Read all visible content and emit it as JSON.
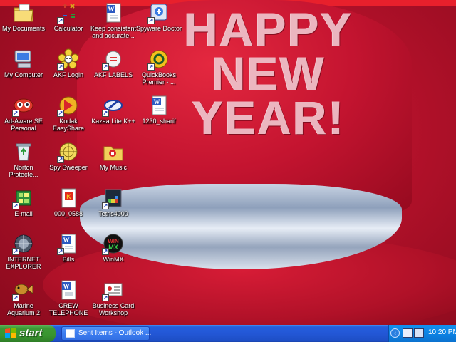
{
  "desktop": {
    "icons": [
      {
        "label": "My Documents",
        "icon": "folder-documents-icon"
      },
      {
        "label": "Calculator",
        "icon": "calculator-icon"
      },
      {
        "label": "Keep consistent and accurate...",
        "icon": "word-document-icon"
      },
      {
        "label": "Spyware Doctor",
        "icon": "spyware-doctor-icon"
      },
      {
        "label": "My Computer",
        "icon": "computer-icon"
      },
      {
        "label": "AKF Login",
        "icon": "flower-icon"
      },
      {
        "label": "AKF LABELS",
        "icon": "labels-icon"
      },
      {
        "label": "QuickBooks Premier - ...",
        "icon": "quickbooks-icon"
      },
      {
        "label": "Ad-Aware SE Personal",
        "icon": "ad-aware-icon"
      },
      {
        "label": "Kodak EasyShare",
        "icon": "kodak-icon"
      },
      {
        "label": "Kazaa Lite K++",
        "icon": "kazaa-icon"
      },
      {
        "label": "1230_sharif",
        "icon": "word-document-icon"
      },
      {
        "label": "Norton Protecte...",
        "icon": "recycle-bin-icon"
      },
      {
        "label": "Spy Sweeper",
        "icon": "spy-sweeper-icon"
      },
      {
        "label": "My Music",
        "icon": "music-icon"
      },
      {
        "label": "E-mail",
        "icon": "email-icon"
      },
      {
        "label": "000_0588",
        "icon": "kodak-image-icon"
      },
      {
        "label": "Tetris4000",
        "icon": "tetris-icon"
      },
      {
        "label": "INTERNET EXPLORER",
        "icon": "globe-icon"
      },
      {
        "label": "Bills",
        "icon": "word-document-icon"
      },
      {
        "label": "WinMX",
        "icon": "winmx-icon"
      },
      {
        "label": "Marine Aquarium 2",
        "icon": "aquarium-icon"
      },
      {
        "label": "CREW TELEPHONE",
        "icon": "word-document-icon"
      },
      {
        "label": "Business Card Workshop",
        "icon": "business-card-icon"
      }
    ]
  },
  "wallpaper": {
    "lines": [
      "HAPPY",
      "NEW",
      "YEAR!"
    ]
  },
  "taskbar": {
    "start_label": "start",
    "task_label": "Sent Items - Outlook ...",
    "clock": "10:20 PM",
    "chevron": "‹"
  },
  "colors": {
    "taskbar_blue": "#245edc",
    "start_green": "#3c9a35",
    "tray_blue": "#0d83e4",
    "wallpaper_red": "#c41430"
  }
}
